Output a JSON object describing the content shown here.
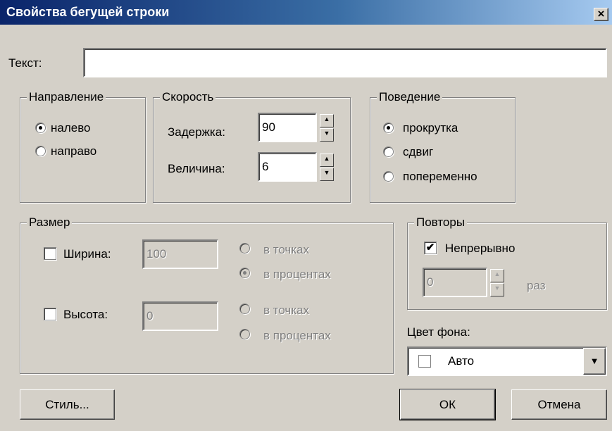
{
  "window": {
    "title": "Свойства бегущей строки",
    "close_glyph": "×"
  },
  "text_field": {
    "label": "Текст:",
    "value": ""
  },
  "direction": {
    "legend": "Направление",
    "options": [
      {
        "label": "налево",
        "selected": true
      },
      {
        "label": "направо",
        "selected": false
      }
    ]
  },
  "speed": {
    "legend": "Скорость",
    "delay_label": "Задержка:",
    "delay_value": "90",
    "amount_label": "Величина:",
    "amount_value": "6"
  },
  "behavior": {
    "legend": "Поведение",
    "options": [
      {
        "label": "прокрутка",
        "selected": true
      },
      {
        "label": "сдвиг",
        "selected": false
      },
      {
        "label": "попеременно",
        "selected": false
      }
    ]
  },
  "size": {
    "legend": "Размер",
    "width": {
      "label": "Ширина:",
      "checked": false,
      "value": "100",
      "unit_points": "в точках",
      "unit_percent": "в процентах",
      "selected_unit": "percent"
    },
    "height": {
      "label": "Высота:",
      "checked": false,
      "value": "0",
      "unit_points": "в точках",
      "unit_percent": "в процентах",
      "selected_unit": "none"
    }
  },
  "repeat": {
    "legend": "Повторы",
    "continuous_label": "Непрерывно",
    "continuous_checked": true,
    "count_value": "0",
    "times_label": "раз"
  },
  "background_color": {
    "label": "Цвет фона:",
    "selected": "Авто",
    "swatch_color": "#ffffff"
  },
  "buttons": {
    "style": "Стиль...",
    "ok": "ОК",
    "cancel": "Отмена"
  },
  "icons": {
    "spin_up": "▲",
    "spin_down": "▼",
    "dropdown": "▼",
    "check": "✔"
  }
}
